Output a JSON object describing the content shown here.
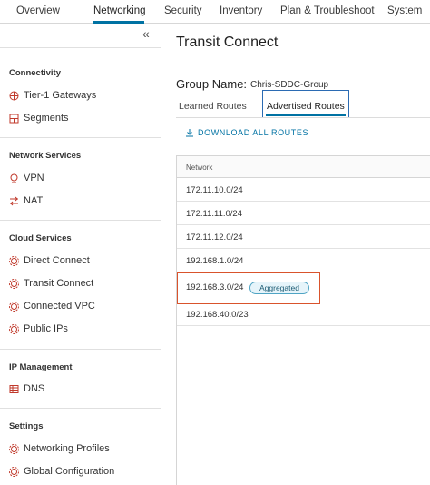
{
  "topnav": {
    "tabs": [
      {
        "label": "Overview"
      },
      {
        "label": "Networking",
        "active": true
      },
      {
        "label": "Security"
      },
      {
        "label": "Inventory"
      },
      {
        "label": "Plan & Troubleshoot"
      },
      {
        "label": "System"
      }
    ]
  },
  "sidebar": {
    "collapse_glyph": "«",
    "sections": [
      {
        "title": "Connectivity",
        "items": [
          {
            "label": "Tier-1 Gateways",
            "icon": "gateway-icon"
          },
          {
            "label": "Segments",
            "icon": "segments-icon"
          }
        ]
      },
      {
        "title": "Network Services",
        "items": [
          {
            "label": "VPN",
            "icon": "vpn-icon"
          },
          {
            "label": "NAT",
            "icon": "nat-icon"
          }
        ]
      },
      {
        "title": "Cloud Services",
        "items": [
          {
            "label": "Direct Connect",
            "icon": "gear-icon"
          },
          {
            "label": "Transit Connect",
            "icon": "gear-icon"
          },
          {
            "label": "Connected VPC",
            "icon": "gear-icon"
          },
          {
            "label": "Public IPs",
            "icon": "gear-icon"
          }
        ]
      },
      {
        "title": "IP Management",
        "items": [
          {
            "label": "DNS",
            "icon": "dns-icon"
          }
        ]
      },
      {
        "title": "Settings",
        "items": [
          {
            "label": "Networking Profiles",
            "icon": "gear-icon"
          },
          {
            "label": "Global Configuration",
            "icon": "gear-icon"
          }
        ]
      }
    ]
  },
  "main": {
    "title": "Transit Connect",
    "group_label": "Group Name:",
    "group_value": "Chris-SDDC-Group",
    "subtabs": [
      {
        "label": "Learned Routes"
      },
      {
        "label": "Advertised Routes",
        "selected": true
      }
    ],
    "download_label": "DOWNLOAD ALL ROUTES",
    "grid": {
      "column": "Network",
      "rows": [
        {
          "network": "172.11.10.0/24"
        },
        {
          "network": "172.11.11.0/24"
        },
        {
          "network": "172.11.12.0/24"
        },
        {
          "network": "192.168.1.0/24"
        },
        {
          "network": "192.168.3.0/24",
          "badge": "Aggregated"
        },
        {
          "network": "192.168.40.0/23"
        }
      ]
    }
  },
  "colors": {
    "accent": "#0072a3",
    "highlight": "#d9532c",
    "selected_box": "#2b6bb3",
    "badge_bg": "#e6f4fa"
  }
}
